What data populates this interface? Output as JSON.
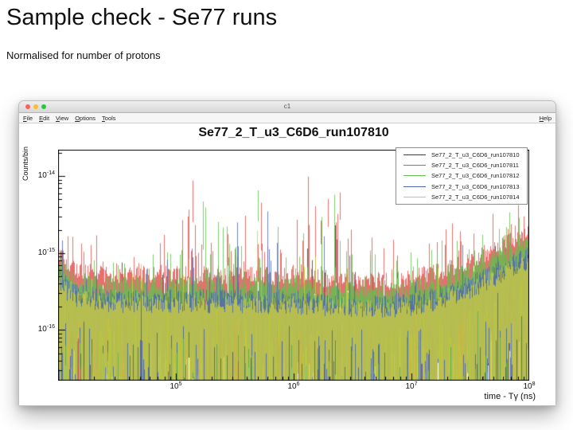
{
  "slide": {
    "title": "Sample check - Se77 runs",
    "subtitle": "Normalised for number of protons"
  },
  "window": {
    "title": "c1",
    "menus": [
      "File",
      "Edit",
      "View",
      "Options",
      "Tools"
    ],
    "help_label": "Help",
    "traffic_lights": [
      "#ff5f57",
      "#febc2e",
      "#28c840"
    ]
  },
  "chart_data": {
    "type": "line",
    "title": "Se77_2_T_u3_C6D6_run107810",
    "xlabel": "time - Tγ (ns)",
    "ylabel": "Counts/bin",
    "xscale": "log",
    "yscale": "log",
    "xlim": [
      10000,
      100000000
    ],
    "ylim": [
      2.2e-17,
      2.2e-14
    ],
    "grid": false,
    "legend_position": "top-right",
    "xticks": [
      {
        "base": "10",
        "exp": "5",
        "value": 100000
      },
      {
        "base": "10",
        "exp": "6",
        "value": 1000000
      },
      {
        "base": "10",
        "exp": "7",
        "value": 10000000
      },
      {
        "base": "10",
        "exp": "8",
        "value": 100000000
      }
    ],
    "yticks": [
      {
        "base": "10",
        "exp": "-14",
        "value": 1e-14
      },
      {
        "base": "10",
        "exp": "-15",
        "value": 1e-15
      },
      {
        "base": "10",
        "exp": "-16",
        "value": 1e-16
      }
    ],
    "series": [
      {
        "name": "Se77_2_T_u3_C6D6_run107810",
        "color": "#3c3c3c",
        "level_scale": 0.36,
        "dip_prob": 0.4
      },
      {
        "name": "Se77_2_T_u3_C6D6_run107811",
        "color": "#e0514e",
        "level_scale": 1.0,
        "dip_prob": 0.4
      },
      {
        "name": "Se77_2_T_u3_C6D6_run107812",
        "color": "#63c04f",
        "level_scale": 0.72,
        "dip_prob": 0.5
      },
      {
        "name": "Se77_2_T_u3_C6D6_run107813",
        "color": "#4d66b5",
        "level_scale": 0.5,
        "dip_prob": 0.45
      },
      {
        "name": "Se77_2_T_u3_C6D6_run107814",
        "color": "#ccce3e",
        "level_scale": 0.42,
        "dip_prob": 0.6
      }
    ],
    "baseline_envelope": {
      "description": "estimated top of the dense overlapping band, value vs log10(time)",
      "points": [
        [
          4.0,
          1.05e-15
        ],
        [
          4.12,
          6.2e-16
        ],
        [
          4.4,
          5.2e-16
        ],
        [
          5.1,
          5.2e-16
        ],
        [
          6.0,
          5e-16
        ],
        [
          6.45,
          4.5e-16
        ],
        [
          6.9,
          4.4e-16
        ],
        [
          7.2,
          5.5e-16
        ],
        [
          7.5,
          8e-16
        ],
        [
          7.75,
          1.2e-15
        ],
        [
          8.0,
          1.9e-15
        ]
      ]
    },
    "spike_region": {
      "x_log10": [
        5.05,
        6.5
      ],
      "peak_x": 750000,
      "max_value": 1.3e-14
    }
  }
}
